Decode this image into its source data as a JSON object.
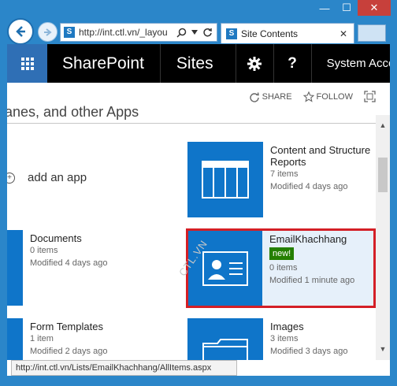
{
  "browser": {
    "address": "http://int.ctl.vn/_layou",
    "tab_title": "Site Contents",
    "favicon_letter": "S",
    "status_url": "http://int.ctl.vn/Lists/EmailKhachhang/AllItems.aspx"
  },
  "window": {
    "minimize_glyph": "—",
    "maximize_glyph": "☐",
    "close_glyph": "✕",
    "accent": "#2b86c9"
  },
  "suite": {
    "brand": "SharePoint",
    "sites": "Sites",
    "help_glyph": "?",
    "account": "System Acco"
  },
  "actions": {
    "share": "SHARE",
    "follow": "FOLLOW"
  },
  "content": {
    "section_title": "anes, and other Apps",
    "add_app": "add an app",
    "watermark": "CTL.VN"
  },
  "tiles": {
    "content_reports": {
      "name": "Content and Structure",
      "name2": "Reports",
      "items": "7 items",
      "modified": "Modified 4 days ago"
    },
    "documents": {
      "name": "Documents",
      "items": "0 items",
      "modified": "Modified 4 days ago"
    },
    "email": {
      "name": "EmailKhachhang",
      "badge": "new!",
      "items": "0 items",
      "modified": "Modified 1 minute ago"
    },
    "form_templates": {
      "name": "Form Templates",
      "items": "1 item",
      "modified": "Modified 2 days ago"
    },
    "images": {
      "name": "Images",
      "items": "3 items",
      "modified": "Modified 3 days ago"
    }
  },
  "colors": {
    "tile_blue": "#0f75c9",
    "highlight_border": "#d41f26",
    "badge_green": "#247f00"
  }
}
